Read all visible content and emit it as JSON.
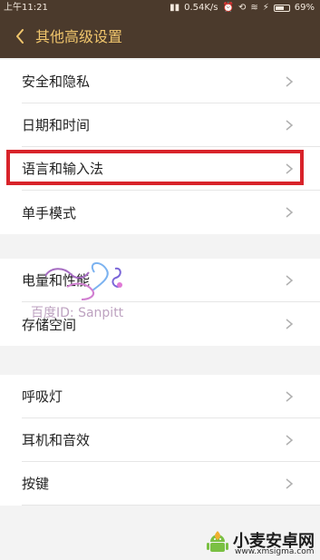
{
  "status_bar": {
    "time": "上午11:21",
    "network_speed": "0.54K/s",
    "battery_percent": "69%",
    "battery_level": 0.69
  },
  "header": {
    "title": "其他高级设置"
  },
  "settings": [
    {
      "label": "安全和隐私"
    },
    {
      "label": "日期和时间"
    },
    {
      "label": "语言和输入法"
    },
    {
      "label": "单手模式"
    },
    {
      "label": "电量和性能"
    },
    {
      "label": "存储空间"
    },
    {
      "label": "呼吸灯"
    },
    {
      "label": "耳机和音效"
    },
    {
      "label": "按键"
    }
  ],
  "colors": {
    "header_bg": "#4b3a2c",
    "accent": "#f0c56c",
    "highlight": "#d8232a"
  },
  "watermark": {
    "text": "百度ID: Sanpitt"
  },
  "footer_logo": {
    "name": "小麦安卓网",
    "url": "www.xmsigma.com"
  }
}
